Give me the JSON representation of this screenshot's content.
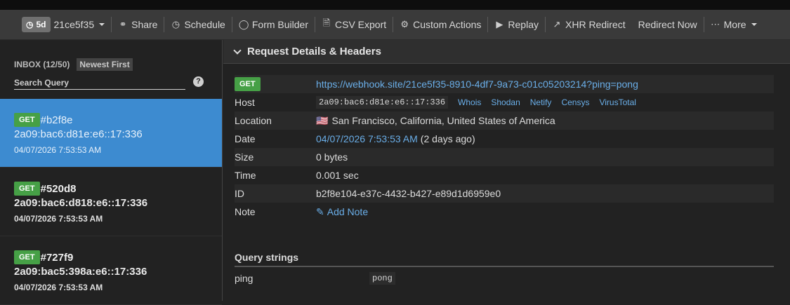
{
  "toolbar": {
    "age_badge": "5d",
    "token_short": "21ce5f35",
    "share": "Share",
    "schedule": "Schedule",
    "form_builder": "Form Builder",
    "csv_export": "CSV Export",
    "custom_actions": "Custom Actions",
    "replay": "Replay",
    "xhr_redirect": "XHR Redirect",
    "redirect_now": "Redirect Now",
    "more": "More"
  },
  "sidebar": {
    "inbox": "INBOX (12/50)",
    "sort": "Newest First",
    "search_placeholder": "Search Query",
    "help": "?",
    "requests": [
      {
        "method": "GET",
        "id": "#b2f8e",
        "ip": "2a09:bac6:d81e:e6::17:336",
        "time": "04/07/2026 7:53:53 AM"
      },
      {
        "method": "GET",
        "id": "#520d8",
        "ip": "2a09:bac6:d818:e6::17:336",
        "time": "04/07/2026 7:53:53 AM"
      },
      {
        "method": "GET",
        "id": "#727f9",
        "ip": "2a09:bac5:398a:e6::17:336",
        "time": "04/07/2026 7:53:53 AM"
      }
    ]
  },
  "details": {
    "heading": "Request Details & Headers",
    "method": "GET",
    "url": "https://webhook.site/21ce5f35-8910-4df7-9a73-c01c05203214?ping=pong",
    "host_label": "Host",
    "host": "2a09:bac6:d81e:e6::17:336",
    "host_links": [
      "Whois",
      "Shodan",
      "Netify",
      "Censys",
      "VirusTotal"
    ],
    "location_label": "Location",
    "location_flag": "🇺🇸",
    "location": "San Francisco, California, United States of America",
    "date_label": "Date",
    "date": "04/07/2026 7:53:53 AM",
    "date_ago": "(2 days ago)",
    "size_label": "Size",
    "size": "0 bytes",
    "time_label": "Time",
    "time": "0.001 sec",
    "id_label": "ID",
    "id": "b2f8e104-e37c-4432-b427-e89d1d6959e0",
    "note_label": "Note",
    "add_note": "Add Note"
  },
  "query": {
    "title": "Query strings",
    "key": "ping",
    "value": "pong"
  }
}
